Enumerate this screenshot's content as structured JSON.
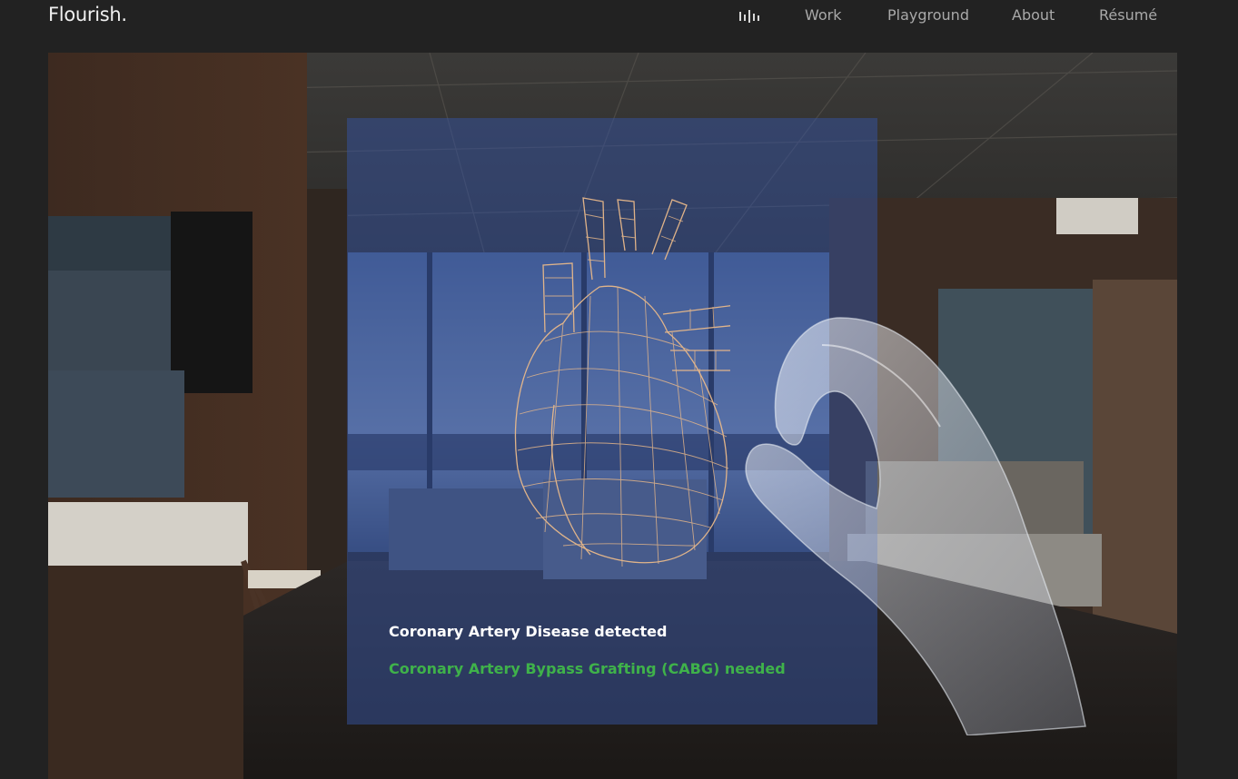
{
  "header": {
    "brand": "Flourish.",
    "sound_icon": "sound-wave-icon",
    "nav": [
      {
        "label": "Work"
      },
      {
        "label": "Playground"
      },
      {
        "label": "About"
      },
      {
        "label": "Résumé"
      }
    ]
  },
  "hero": {
    "image_subject": "hospital-room-ar-heart",
    "overlay": {
      "icons": [
        "heart-wireframe-icon",
        "hand-icon"
      ],
      "diagnosis_text": "Coronary Artery Disease detected",
      "recommendation_text": "Coronary Artery Bypass Grafting (CABG) needed"
    }
  },
  "colors": {
    "background": "#222222",
    "nav_text": "#a9a9a9",
    "brand_text": "#f0f0f0",
    "overlay_panel": "#36529e",
    "heart_wireframe": "#e9b98a",
    "recommendation_text": "#3fb24a"
  }
}
